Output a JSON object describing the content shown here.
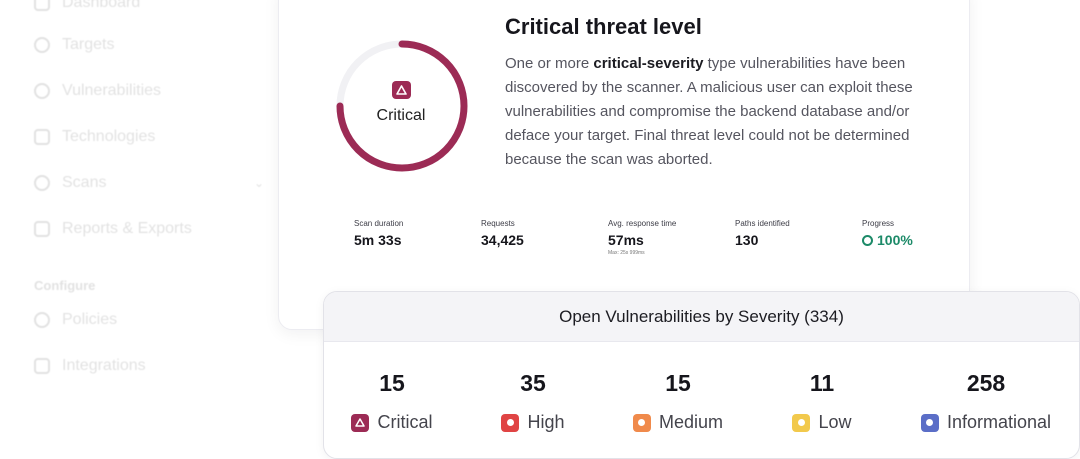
{
  "sidebar": {
    "items": [
      {
        "label": "Dashboard",
        "icon": "dashboard-icon"
      },
      {
        "label": "Targets",
        "icon": "target-icon"
      },
      {
        "label": "Vulnerabilities",
        "icon": "bug-icon"
      },
      {
        "label": "Technologies",
        "icon": "layers-icon"
      },
      {
        "label": "Scans",
        "icon": "radar-icon"
      },
      {
        "label": "Reports & Exports",
        "icon": "document-icon"
      },
      {
        "label": "Policies",
        "icon": "gear-icon"
      },
      {
        "label": "Integrations",
        "icon": "plug-icon"
      }
    ],
    "section_label": "Configure"
  },
  "threat": {
    "title": "Critical threat level",
    "gauge_label": "Critical",
    "gauge_color": "#9c2b55",
    "desc_before": "One or more ",
    "desc_bold": "critical-severity",
    "desc_after": " type vulnerabilities have been discovered by the scanner. A malicious user can exploit these vulnerabilities and compromise the backend database and/or deface your target. Final threat level could not be determined because the scan was aborted."
  },
  "stats": {
    "duration": {
      "label": "Scan duration",
      "value": "5m 33s"
    },
    "requests": {
      "label": "Requests",
      "value": "34,425"
    },
    "response": {
      "label": "Avg. response time",
      "value": "57ms",
      "sub": "Max: 25s 999ms"
    },
    "paths": {
      "label": "Paths identified",
      "value": "130"
    },
    "progress": {
      "label": "Progress",
      "value": "100%",
      "percent": 100,
      "color": "#1c8a68"
    }
  },
  "vulnerabilities": {
    "title": "Open Vulnerabilities by Severity (334)",
    "items": [
      {
        "count": "15",
        "label": "Critical",
        "color": "#9c2b55",
        "icon": "critical-triangle-icon"
      },
      {
        "count": "35",
        "label": "High",
        "color": "#e04444",
        "icon": "high-icon"
      },
      {
        "count": "15",
        "label": "Medium",
        "color": "#f08a4b",
        "icon": "medium-icon"
      },
      {
        "count": "11",
        "label": "Low",
        "color": "#f2c94c",
        "icon": "low-icon"
      },
      {
        "count": "258",
        "label": "Informational",
        "color": "#5b6ec7",
        "icon": "info-icon"
      }
    ]
  }
}
